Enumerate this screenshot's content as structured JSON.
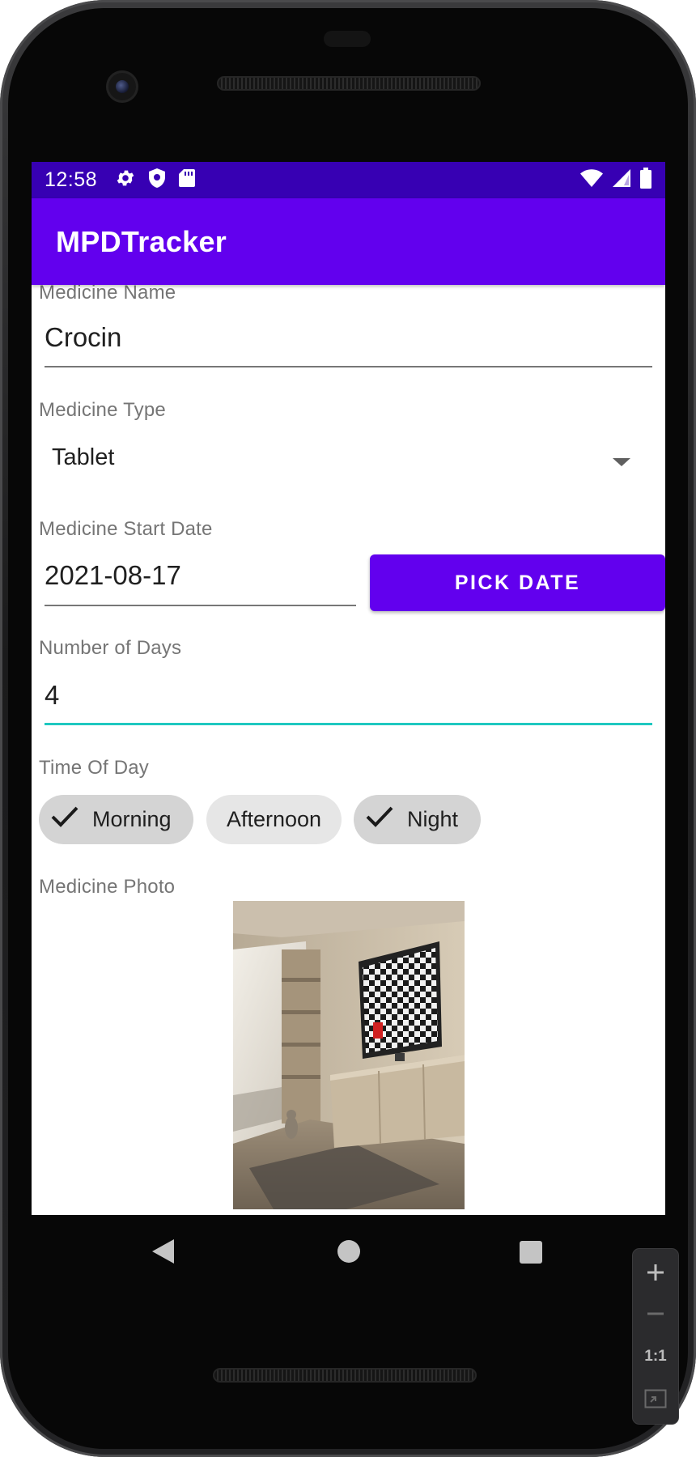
{
  "status_bar": {
    "time": "12:58",
    "left_icons": [
      "gear-icon",
      "shield-icon",
      "sd-card-icon"
    ],
    "right_icons": [
      "wifi-icon",
      "signal-icon",
      "battery-icon"
    ],
    "color": "#3700b3"
  },
  "app_bar": {
    "title": "MPDTracker",
    "color": "#6200ee"
  },
  "form": {
    "medicine_name": {
      "label": "Medicine Name",
      "value": "Crocin"
    },
    "medicine_type": {
      "label": "Medicine Type",
      "selected": "Tablet"
    },
    "start_date": {
      "label": "Medicine Start Date",
      "value": "2021-08-17",
      "button_label": "PICK DATE"
    },
    "number_of_days": {
      "label": "Number of Days",
      "value": "4",
      "focus_color": "#1ec8c0"
    },
    "time_of_day": {
      "label": "Time Of Day",
      "chips": [
        {
          "label": "Morning",
          "checked": true
        },
        {
          "label": "Afternoon",
          "checked": false
        },
        {
          "label": "Night",
          "checked": true
        }
      ]
    },
    "photo": {
      "label": "Medicine Photo"
    }
  },
  "nav_bar": {
    "buttons": [
      "back-icon",
      "home-icon",
      "recents-icon"
    ]
  },
  "zoom_toolbar": {
    "zoom_in_icon": "plus-icon",
    "zoom_out_icon": "minus-icon",
    "actual_size_label": "1:1",
    "fit_icon": "fit-screen-icon"
  }
}
